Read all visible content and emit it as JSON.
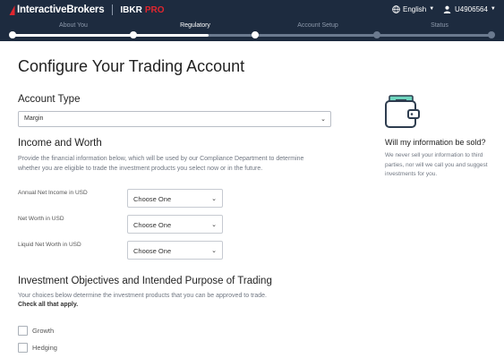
{
  "header": {
    "brand_name": "InteractiveBrokers",
    "product_prefix": "IBKR",
    "product_suffix": "PRO",
    "language": "English",
    "username": "U4906564",
    "brand_color": "#e0262f",
    "bar_color": "#1d2b3f"
  },
  "progress": {
    "steps": [
      {
        "label": "About You",
        "state": "done"
      },
      {
        "label": "Regulatory",
        "state": "active"
      },
      {
        "label": "Account Setup",
        "state": "upcoming"
      },
      {
        "label": "Status",
        "state": "upcoming"
      }
    ],
    "completed_fraction": 0.41
  },
  "page": {
    "title": "Configure Your Trading Account"
  },
  "account_type": {
    "heading": "Account Type",
    "value": "Margin"
  },
  "income": {
    "heading": "Income and Worth",
    "description_line1": "Provide the financial information below, which will be used by our Compliance Department to determine",
    "description_line2": "whether you are eligible to trade the investment products you select now or in the future.",
    "fields": [
      {
        "label": "Annual Net Income in USD",
        "value": "Choose One"
      },
      {
        "label": "Net Worth in USD",
        "value": "Choose One"
      },
      {
        "label": "Liquid Net Worth in USD",
        "value": "Choose One"
      }
    ]
  },
  "objectives": {
    "heading": "Investment Objectives and Intended Purpose of Trading",
    "description": "Your choices below determine the investment products that you can be approved to trade.",
    "instruction": "Check all that apply.",
    "options": [
      {
        "label": "Growth",
        "checked": false
      },
      {
        "label": "Hedging",
        "checked": false
      }
    ]
  },
  "sidebar": {
    "icon": "wallet-icon",
    "title": "Will my information be sold?",
    "text": "We never sell your information to third parties, nor will we call you and suggest investments for you."
  }
}
